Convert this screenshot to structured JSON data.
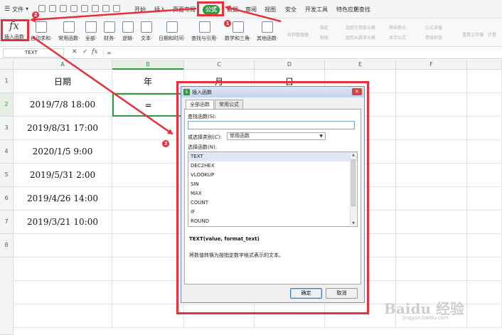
{
  "menubar": {
    "file_label": "文件",
    "tabs": [
      {
        "label": "开始"
      },
      {
        "label": "插入"
      },
      {
        "label": "页面布局"
      },
      {
        "label": "公式",
        "active": true
      },
      {
        "label": "数据"
      },
      {
        "label": "审阅"
      },
      {
        "label": "视图"
      },
      {
        "label": "安全"
      },
      {
        "label": "开发工具"
      },
      {
        "label": "特色应用"
      }
    ],
    "search_label": "查找"
  },
  "ribbon": {
    "insert_function": "插入函数",
    "buttons": [
      {
        "label": "自动求和·"
      },
      {
        "label": "常用函数·"
      },
      {
        "label": "全部·"
      },
      {
        "label": "财务·"
      },
      {
        "label": "逻辑·"
      },
      {
        "label": "文本·"
      },
      {
        "label": "日期和时间·"
      },
      {
        "label": "查找与引用·"
      },
      {
        "label": "数学和三角·"
      },
      {
        "label": "其他函数·"
      }
    ],
    "grey_items": [
      "名称管理器",
      "指定",
      "粘贴",
      "追踪引用单元格",
      "追踪从属单元格",
      "移去箭头",
      "显示公式",
      "公式求值",
      "错误检查",
      "重算工作簿",
      "计算"
    ]
  },
  "formula_bar": {
    "name_box": "TEXT",
    "cancel": "✕",
    "enter": "✓",
    "fx": "fx",
    "content": "="
  },
  "sheet": {
    "columns": [
      "A",
      "B",
      "C",
      "D",
      "E",
      "F"
    ],
    "rows": [
      "1",
      "2",
      "3",
      "4",
      "5",
      "6",
      "7",
      "8"
    ],
    "headers": {
      "a": "日期",
      "b": "年",
      "c": "月",
      "d": "日"
    },
    "dates": [
      "2019/7/8 18:00",
      "2019/8/31 17:00",
      "2020/1/5 9:00",
      "2019/5/31 2:00",
      "2019/4/26 14:00",
      "2019/3/21 10:00"
    ],
    "active_cell_value": "="
  },
  "dialog": {
    "title": "插入函数",
    "close": "✕",
    "tabs": [
      {
        "label": "全部函数",
        "active": true
      },
      {
        "label": "常用公式"
      }
    ],
    "search_label": "查找函数(S):",
    "category_label": "或选择类别(C):",
    "category_value": "常用函数",
    "list_label": "选择函数(N):",
    "functions": [
      "TEXT",
      "DEC2HEX",
      "VLOOKUP",
      "SIN",
      "MAX",
      "COUNT",
      "IF",
      "ROUND"
    ],
    "selected_function": "TEXT",
    "syntax": "TEXT(value, format_text)",
    "description": "将数值转换为按指定数字格式表示的文本。",
    "ok": "确定",
    "cancel": "取消"
  },
  "annotations": {
    "badges": [
      "1",
      "2",
      "3"
    ],
    "color": "#e8303a"
  },
  "watermark": {
    "text": "Baidu 经验",
    "sub": "jingyan.baidu.com"
  },
  "colors": {
    "accent": "#2f9a3e",
    "annotation": "#e8303a"
  }
}
